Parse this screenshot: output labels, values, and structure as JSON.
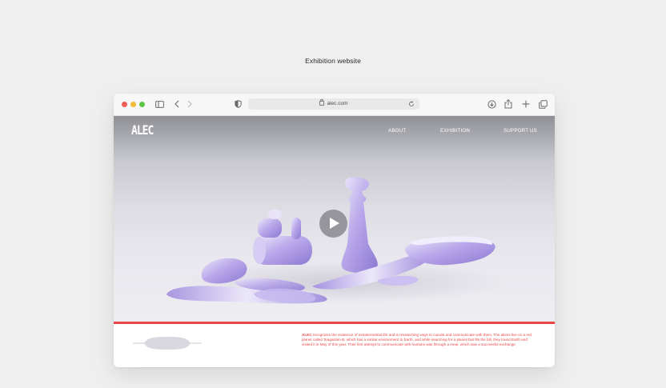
{
  "caption": "Exhibition website",
  "browser": {
    "url": "alec.com",
    "icons": [
      "sidebar-icon",
      "back-icon",
      "forward-icon",
      "privacy-shield-icon",
      "lock-icon",
      "reload-icon",
      "download-icon",
      "share-icon",
      "new-tab-icon",
      "tabs-icon"
    ]
  },
  "site": {
    "logo": "ALEC",
    "nav": {
      "about": "ABOUT",
      "exhibition": "EXHIBITION",
      "support": "SUPPORT US"
    },
    "video": {
      "play_label": "Play"
    },
    "footer": {
      "brand": "ALEC",
      "description": "recognizes the existence of extraterrestrial life and is researching ways to coexist and communicate with them. The aliens live on a red planet called Teagarden-B, which has a similar environment to Earth, and while searching for a planet that fits the bill, they found Earth and visited it in May of this year. Their first attempt to communicate with humans was through a meal, which was a successful exchange."
    }
  },
  "colors": {
    "accent_red": "#e8474a",
    "object_lavender": "#b3a3e6",
    "hero_top": "#8f9096",
    "hero_bottom": "#eeedf2"
  }
}
